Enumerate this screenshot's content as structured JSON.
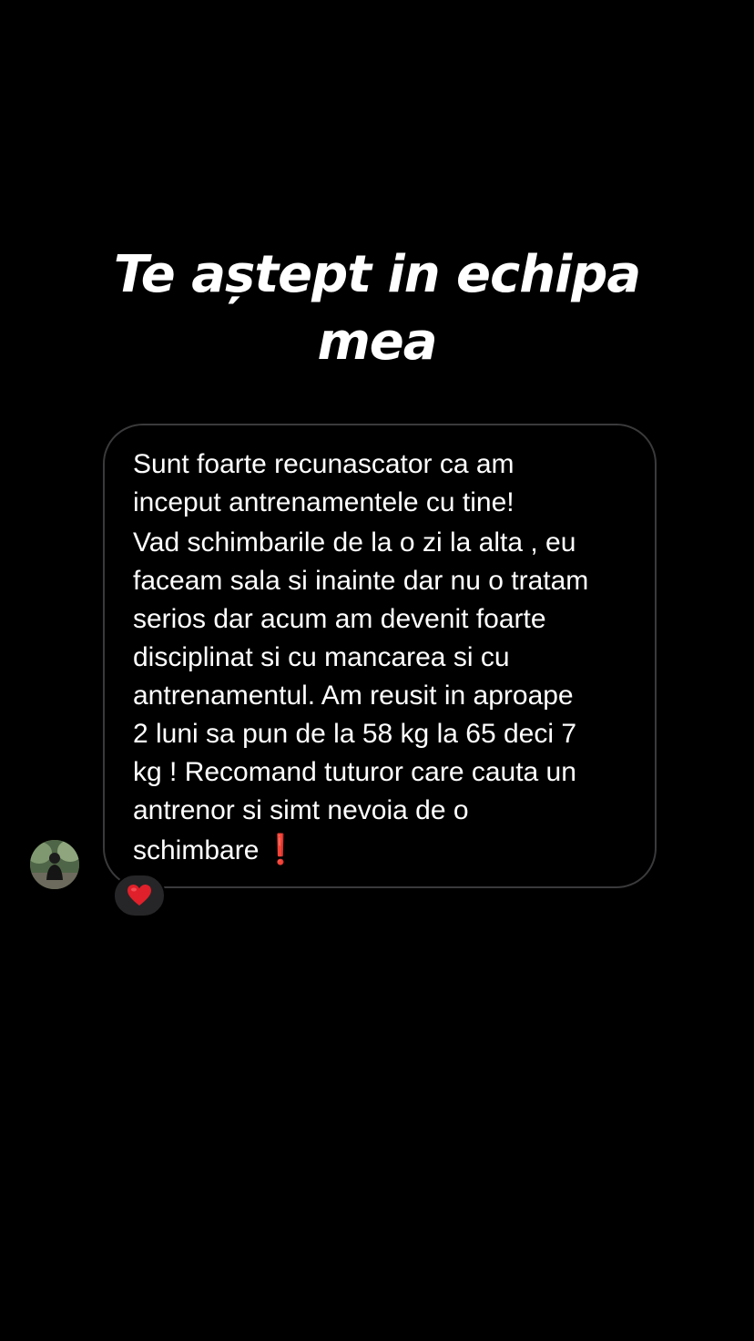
{
  "title": {
    "line1": "Te aștept in echipa",
    "line2": "mea"
  },
  "message": {
    "lines": [
      "Sunt foarte recunascator ca am",
      "inceput antrenamentele cu tine!",
      "Vad schimbarile de la o zi la alta , eu",
      "faceam sala si inainte dar nu o tratam",
      "serios dar acum am devenit foarte",
      "disciplinat si cu mancarea si cu",
      "antrenamentul. Am reusit in aproape",
      "2 luni sa pun de la 58 kg la 65 deci 7",
      "kg ! Recomand tuturor care cauta un",
      "antrenor si simt nevoia de o",
      "schimbare"
    ],
    "trailing_emoji": "❗"
  },
  "reaction": {
    "emoji": "heart",
    "color": "#e0202a"
  },
  "avatar": {
    "icon": "user-avatar"
  },
  "colors": {
    "background": "#000000",
    "bubble_border": "#3a3a3c",
    "reaction_bg": "#262628",
    "text": "#ffffff"
  }
}
